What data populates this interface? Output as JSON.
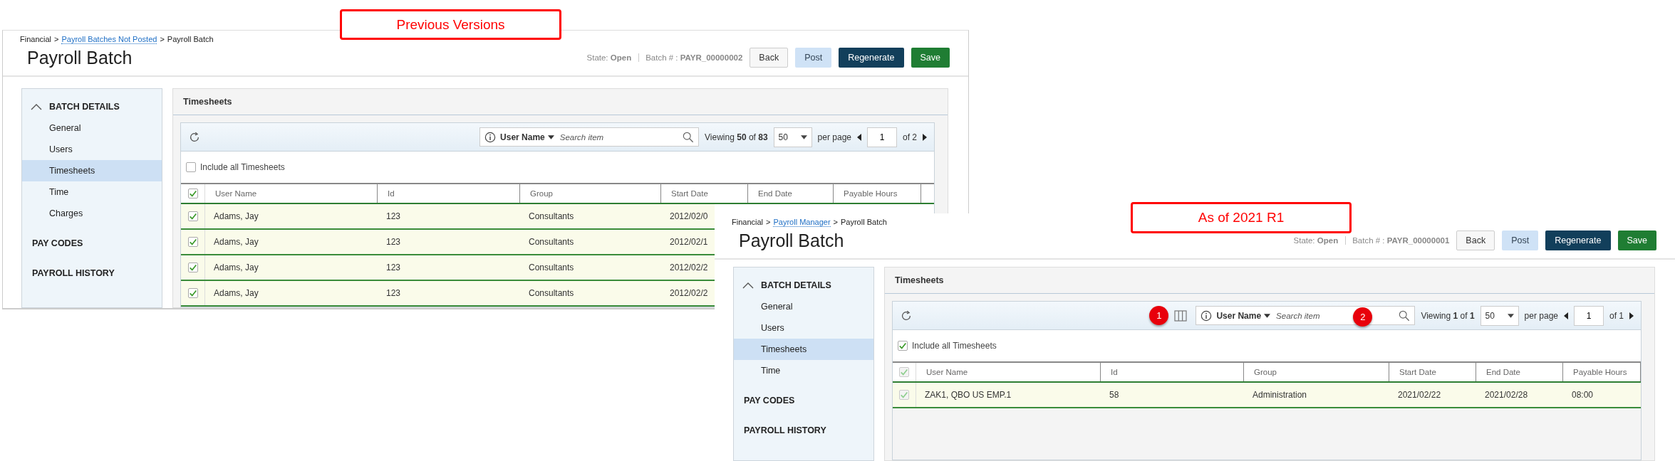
{
  "screens": [
    {
      "callout": "Previous Versions",
      "breadcrumb": {
        "separator": ">",
        "items": [
          {
            "text": "Financial",
            "link": false
          },
          {
            "text": "Payroll Batches Not Posted",
            "link": true
          },
          {
            "text": "Payroll Batch",
            "link": false
          }
        ]
      },
      "title": "Payroll Batch",
      "state": "State: **Open**",
      "batch": "Batch # : **PAYR_00000002**",
      "buttons": [
        {
          "label": "Back",
          "kind": "default"
        },
        {
          "label": "Post",
          "kind": "light"
        },
        {
          "label": "Regenerate",
          "kind": "dark"
        },
        {
          "label": "Save",
          "kind": "save"
        }
      ],
      "sidebar": {
        "sections": [
          {
            "label": "BATCH DETAILS",
            "expanded": true,
            "children": [
              {
                "label": "General",
                "selected": false
              },
              {
                "label": "Users",
                "selected": false
              },
              {
                "label": "Timesheets",
                "selected": true
              },
              {
                "label": "Time",
                "selected": false
              },
              {
                "label": "Charges",
                "selected": false
              }
            ]
          },
          {
            "label": "PAY CODES",
            "expanded": false
          },
          {
            "label": "PAYROLL HISTORY",
            "expanded": false
          }
        ]
      },
      "panel_title": "Timesheets",
      "toolbar": {
        "column_chooser": false,
        "search_by": "User Name",
        "placeholder": "Search item",
        "viewing": "Viewing **50** of **83**",
        "per_page": "50",
        "per_page_label": "per page",
        "page": "1",
        "page_count": "of 2"
      },
      "include_all": {
        "label": "Include all Timesheets",
        "checked": false
      },
      "table": {
        "header_checked": true,
        "header_disabled": false,
        "columns": [
          "User Name",
          "Id",
          "Group",
          "Start Date",
          "End Date",
          "Payable Hours"
        ],
        "rows": [
          {
            "checked": true,
            "disabled": false,
            "cells": [
              "Adams, Jay",
              "123",
              "Consultants",
              "2012/02/0"
            ]
          },
          {
            "checked": true,
            "disabled": false,
            "cells": [
              "Adams, Jay",
              "123",
              "Consultants",
              "2012/02/1"
            ]
          },
          {
            "checked": true,
            "disabled": false,
            "cells": [
              "Adams, Jay",
              "123",
              "Consultants",
              "2012/02/2"
            ]
          },
          {
            "checked": true,
            "disabled": false,
            "cells": [
              "Adams, Jay",
              "123",
              "Consultants",
              "2012/02/2"
            ]
          }
        ]
      }
    },
    {
      "callout": "As of 2021 R1",
      "breadcrumb": {
        "separator": ">",
        "items": [
          {
            "text": "Financial",
            "link": false
          },
          {
            "text": "Payroll Manager",
            "link": true
          },
          {
            "text": "Payroll Batch",
            "link": false
          }
        ]
      },
      "title": "Payroll Batch",
      "state": "State: **Open**",
      "batch": "Batch # : **PAYR_00000001**",
      "buttons": [
        {
          "label": "Back",
          "kind": "default"
        },
        {
          "label": "Post",
          "kind": "light"
        },
        {
          "label": "Regenerate",
          "kind": "dark"
        },
        {
          "label": "Save",
          "kind": "save"
        }
      ],
      "sidebar": {
        "sections": [
          {
            "label": "BATCH DETAILS",
            "expanded": true,
            "children": [
              {
                "label": "General",
                "selected": false
              },
              {
                "label": "Users",
                "selected": false
              },
              {
                "label": "Timesheets",
                "selected": true
              },
              {
                "label": "Time",
                "selected": false
              }
            ]
          },
          {
            "label": "PAY CODES",
            "expanded": false
          },
          {
            "label": "PAYROLL HISTORY",
            "expanded": false
          }
        ]
      },
      "panel_title": "Timesheets",
      "toolbar": {
        "column_chooser": true,
        "badges": [
          {
            "text": "1",
            "kind": "column-chooser"
          },
          {
            "text": "2",
            "kind": "search"
          }
        ],
        "search_by": "User Name",
        "placeholder": "Search item",
        "viewing": "Viewing **1** of **1**",
        "per_page": "50",
        "per_page_label": "per page",
        "page": "1",
        "page_count": "of 1"
      },
      "include_all": {
        "label": "Include all Timesheets",
        "checked": true
      },
      "table": {
        "header_checked": true,
        "header_disabled": true,
        "columns": [
          "User Name",
          "Id",
          "Group",
          "Start Date",
          "End Date",
          "Payable Hours"
        ],
        "rows": [
          {
            "checked": true,
            "disabled": true,
            "cells": [
              "ZAK1, QBO US EMP.1",
              "58",
              "Administration",
              "2021/02/22",
              "2021/02/28",
              "08:00"
            ]
          }
        ]
      }
    }
  ]
}
